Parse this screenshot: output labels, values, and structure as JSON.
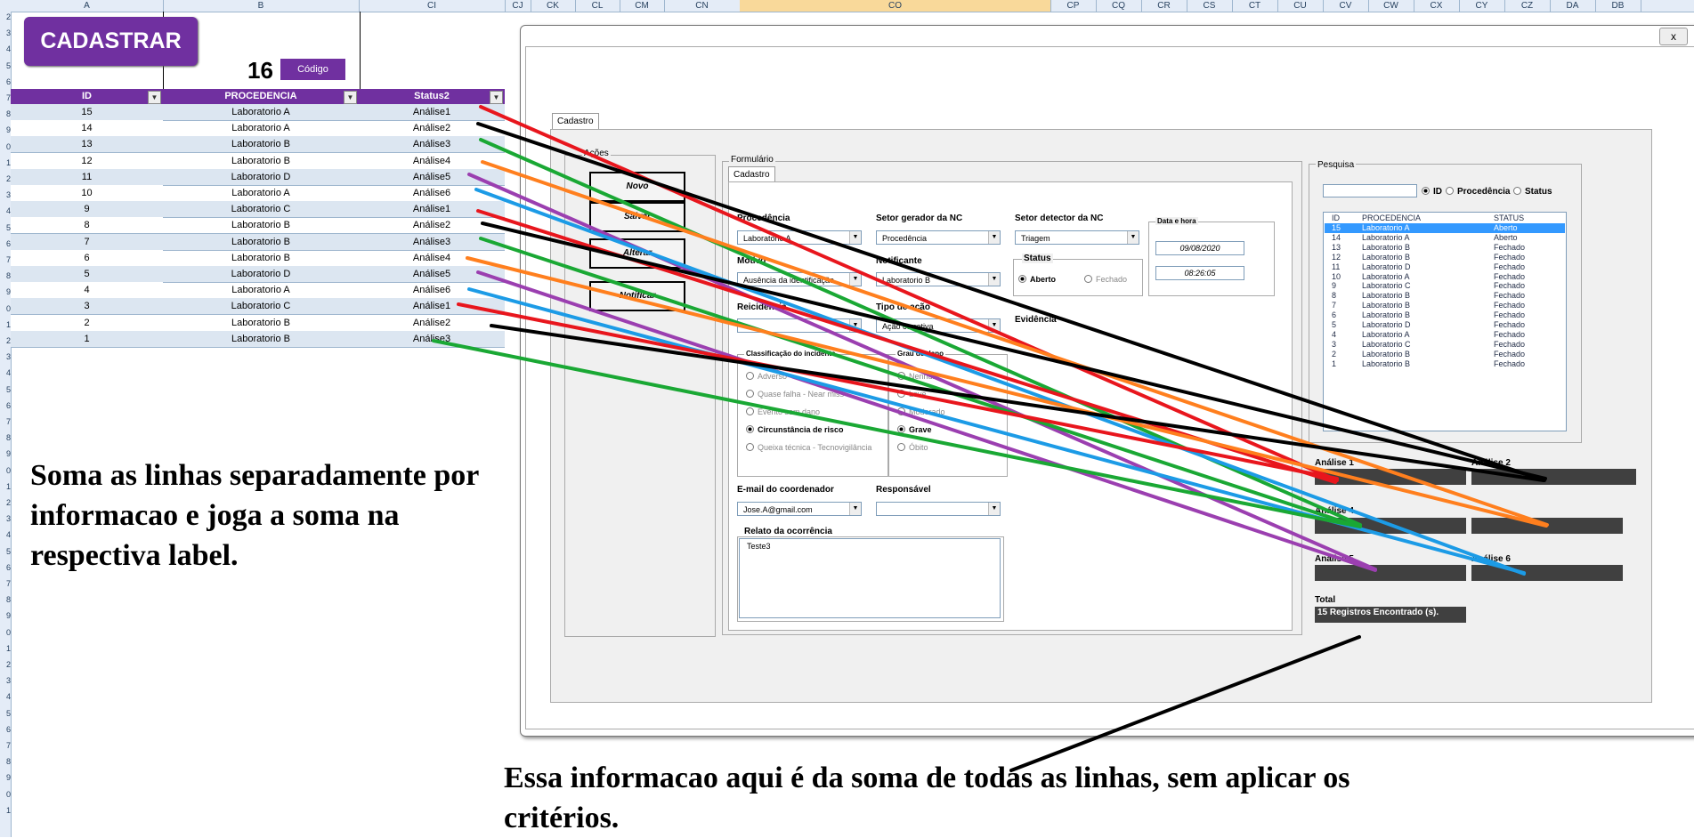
{
  "excel": {
    "columns": [
      {
        "label": "A",
        "w": 171
      },
      {
        "label": "B",
        "w": 220
      },
      {
        "label": "CI",
        "w": 164
      },
      {
        "label": "CJ",
        "w": 29
      },
      {
        "label": "CK",
        "w": 50
      },
      {
        "label": "CL",
        "w": 50
      },
      {
        "label": "CM",
        "w": 50
      },
      {
        "label": "CN",
        "w": 85
      },
      {
        "label": "CO",
        "w": 349
      },
      {
        "label": "CP",
        "w": 51
      },
      {
        "label": "CQ",
        "w": 51
      },
      {
        "label": "CR",
        "w": 51
      },
      {
        "label": "CS",
        "w": 51
      },
      {
        "label": "CT",
        "w": 51
      },
      {
        "label": "CU",
        "w": 51
      },
      {
        "label": "CV",
        "w": 51
      },
      {
        "label": "CW",
        "w": 51
      },
      {
        "label": "CX",
        "w": 51
      },
      {
        "label": "CY",
        "w": 51
      },
      {
        "label": "CZ",
        "w": 51
      },
      {
        "label": "DA",
        "w": 51
      },
      {
        "label": "DB",
        "w": 51
      }
    ],
    "row_numbers": [
      "2",
      "3",
      "4",
      "5",
      "6",
      "7",
      "8",
      "9",
      "0",
      "1",
      "2",
      "3",
      "4",
      "5",
      "6",
      "7",
      "8",
      "9",
      "0",
      "1",
      "2",
      "3",
      "4",
      "5",
      "6",
      "7",
      "8",
      "9",
      "0",
      "1",
      "2",
      "3",
      "4",
      "5",
      "6",
      "7",
      "8",
      "9",
      "0",
      "1",
      "2",
      "3",
      "4",
      "5",
      "6",
      "7",
      "8",
      "9",
      "0",
      "1"
    ],
    "cadastrar_label": "CADASTRAR",
    "record_count": "16",
    "codigo_label": "Código",
    "table": {
      "headers": [
        "ID",
        "PROCEDENCIA",
        "Status2"
      ],
      "rows": [
        [
          "15",
          "Laboratorio A",
          "Análise1"
        ],
        [
          "14",
          "Laboratorio A",
          "Análise2"
        ],
        [
          "13",
          "Laboratorio B",
          "Análise3"
        ],
        [
          "12",
          "Laboratorio B",
          "Análise4"
        ],
        [
          "11",
          "Laboratorio D",
          "Análise5"
        ],
        [
          "10",
          "Laboratorio A",
          "Análise6"
        ],
        [
          "9",
          "Laboratorio C",
          "Análise1"
        ],
        [
          "8",
          "Laboratorio B",
          "Análise2"
        ],
        [
          "7",
          "Laboratorio B",
          "Análise3"
        ],
        [
          "6",
          "Laboratorio B",
          "Análise4"
        ],
        [
          "5",
          "Laboratorio D",
          "Análise5"
        ],
        [
          "4",
          "Laboratorio A",
          "Análise6"
        ],
        [
          "3",
          "Laboratorio C",
          "Análise1"
        ],
        [
          "2",
          "Laboratorio B",
          "Análise2"
        ],
        [
          "1",
          "Laboratorio B",
          "Análise3"
        ]
      ]
    }
  },
  "annotations": {
    "note1": "Soma as linhas separadamente por informacao e joga a soma na respectiva label.",
    "note2": "Essa informacao aqui é da soma de todas as linhas, sem aplicar os critérios."
  },
  "form": {
    "close": "x",
    "outer_tab": "Cadastro",
    "acoes_group": "Ações",
    "buttons": [
      "Novo",
      "Salvar",
      "Alterar",
      "Notificar"
    ],
    "formulario_group": "Formulário",
    "inner_tab": "Cadastro",
    "procedencia_label": "Procedência",
    "procedencia_value": "Laboratorio A",
    "setor_gerador_label": "Setor gerador da NC",
    "setor_gerador_value": "Procedência",
    "setor_detector_label": "Setor detector da NC",
    "setor_detector_value": "Triagem",
    "data_hora_label": "Data e hora",
    "date_value": "09/08/2020",
    "time_value": "08:26:05",
    "motivo_label": "Motivo",
    "motivo_value": "Ausência da identificação",
    "notificante_label": "Notificante",
    "notificante_value": "Laboratorio B",
    "status_label": "Status",
    "status_aberto": "Aberto",
    "status_fechado": "Fechado",
    "reicidencia_label": "Reicidência",
    "tipo_acao_label": "Tipo de ação",
    "tipo_acao_value": "Ação corretiva",
    "evidencia_label": "Evidência",
    "classificacao_label": "Classificação do incidente",
    "classificacao_options": [
      "Adverso",
      "Quase falha - Near miss",
      "Evento sem dano",
      "Circunstância de risco",
      "Queixa técnica - Tecnovigilância"
    ],
    "grau_label": "Grau do dano",
    "grau_options": [
      "Nenhum",
      "Leve",
      "Moderado",
      "Grave",
      "Óbito"
    ],
    "email_label": "E-mail do coordenador",
    "email_value": "Jose.A@gmail.com",
    "responsavel_label": "Responsável",
    "relato_label": "Relato da ocorrência",
    "relato_value": "Teste3",
    "pesquisa_group": "Pesquisa",
    "search_options": [
      "ID",
      "Procedência",
      "Status"
    ],
    "list_headers": [
      "ID",
      "PROCEDENCIA",
      "STATUS"
    ],
    "list_rows": [
      [
        "15",
        "Laboratorio A",
        "Aberto"
      ],
      [
        "14",
        "Laboratorio A",
        "Aberto"
      ],
      [
        "13",
        "Laboratorio B",
        "Fechado"
      ],
      [
        "12",
        "Laboratorio B",
        "Fechado"
      ],
      [
        "11",
        "Laboratorio D",
        "Fechado"
      ],
      [
        "10",
        "Laboratorio A",
        "Fechado"
      ],
      [
        "9",
        "Laboratorio C",
        "Fechado"
      ],
      [
        "8",
        "Laboratorio B",
        "Fechado"
      ],
      [
        "7",
        "Laboratorio B",
        "Fechado"
      ],
      [
        "6",
        "Laboratorio B",
        "Fechado"
      ],
      [
        "5",
        "Laboratorio D",
        "Fechado"
      ],
      [
        "4",
        "Laboratorio A",
        "Fechado"
      ],
      [
        "3",
        "Laboratorio C",
        "Fechado"
      ],
      [
        "2",
        "Laboratorio B",
        "Fechado"
      ],
      [
        "1",
        "Laboratorio B",
        "Fechado"
      ]
    ],
    "analise_labels": [
      "Análise 1",
      "Análise 2",
      "Análise 4",
      "Análise 5",
      "Análise 6"
    ],
    "total_label": "Total",
    "total_value": "15 Registros Encontrado (s)."
  },
  "colors": {
    "purple": "#7030a0",
    "arrows": [
      "#e8161d",
      "#000000",
      "#1aa834",
      "#ff7f1e",
      "#9b3fb0",
      "#1c9be6"
    ]
  }
}
